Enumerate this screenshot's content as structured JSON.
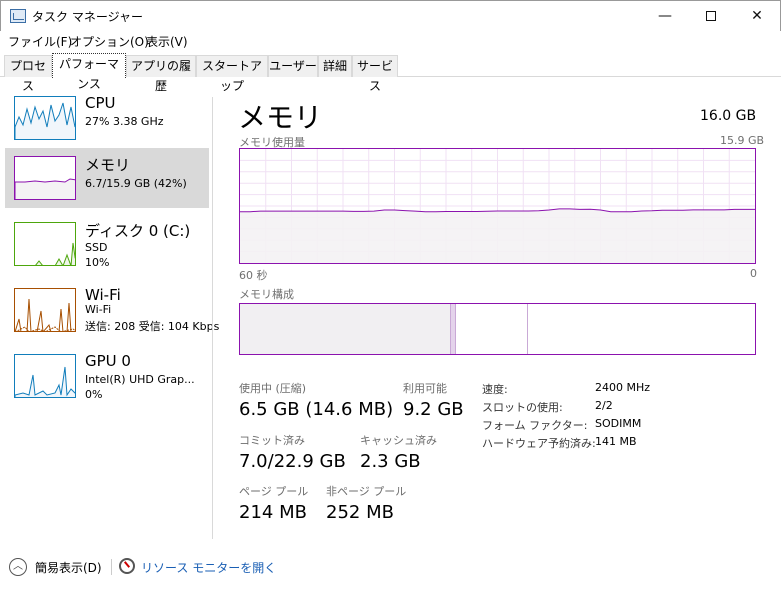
{
  "window": {
    "title": "タスク マネージャー",
    "minimize": "—",
    "close": "✕"
  },
  "menu": [
    "ファイル(F)",
    "オプション(O)",
    "表示(V)"
  ],
  "tabs": [
    "プロセス",
    "パフォーマンス",
    "アプリの履歴",
    "スタートアップ",
    "ユーザー",
    "詳細",
    "サービス"
  ],
  "active_tab": "パフォーマンス",
  "sidebar": [
    {
      "title": "CPU",
      "line1": "27%  3.38 GHz",
      "line2": "",
      "line3": "",
      "color": "#117dbb"
    },
    {
      "title": "メモリ",
      "line1": "6.7/15.9 GB (42%)",
      "line2": "",
      "line3": "",
      "color": "#8b12ae"
    },
    {
      "title": "ディスク 0 (C:)",
      "line1": "SSD",
      "line2": "10%",
      "line3": "",
      "color": "#4da60c"
    },
    {
      "title": "Wi-Fi",
      "line1": "Wi-Fi",
      "line2": "送信: 208  受信: 104 Kbps",
      "line3": "",
      "color": "#a74f01"
    },
    {
      "title": "GPU 0",
      "line1": "Intel(R) UHD Grap...",
      "line2": "0%",
      "line3": "",
      "color": "#117dbb"
    }
  ],
  "main": {
    "title": "メモリ",
    "total": "16.0 GB",
    "usage_label": "メモリ使用量",
    "usage_max": "15.9 GB",
    "time_left": "60 秒",
    "time_right": "0",
    "composition_label": "メモリ構成",
    "usage_history_percent": [
      45,
      45,
      45.5,
      45.5,
      45.5,
      45.5,
      45.5,
      45.5,
      45.5,
      45.5,
      45.5,
      45.3,
      45.3,
      45.5,
      46.5,
      46.5,
      46,
      45.5,
      45,
      45,
      45.2,
      45.2,
      45.2,
      45.2,
      45.4,
      45.6,
      45.6,
      45.6,
      45.6,
      45.9,
      46.5,
      47.5,
      47.5,
      47,
      47.2,
      46.5,
      45,
      45,
      45,
      45.6,
      45.8,
      46.3,
      46.3,
      46.3,
      46.6,
      46.6,
      46.6,
      46.6,
      47,
      47,
      47
    ],
    "composition": {
      "in_use_percent": 41,
      "modified_percent": 1,
      "standby_percent": 14
    },
    "accent_color": "#8b12ae"
  },
  "stats": {
    "in_use_label": "使用中 (圧縮)",
    "in_use_value": "6.5 GB (14.6 MB)",
    "available_label": "利用可能",
    "available_value": "9.2 GB",
    "committed_label": "コミット済み",
    "committed_value": "7.0/22.9 GB",
    "cached_label": "キャッシュ済み",
    "cached_value": "2.3 GB",
    "paged_label": "ページ プール",
    "paged_value": "214 MB",
    "nonpaged_label": "非ページ プール",
    "nonpaged_value": "252 MB"
  },
  "info": [
    {
      "label": "速度:",
      "value": "2400 MHz"
    },
    {
      "label": "スロットの使用:",
      "value": "2/2"
    },
    {
      "label": "フォーム ファクター:",
      "value": "SODIMM"
    },
    {
      "label": "ハードウェア予約済み:",
      "value": "141 MB"
    }
  ],
  "footer": {
    "fewer_details": "簡易表示(D)",
    "resource_monitor": "リソース モニターを開く"
  }
}
